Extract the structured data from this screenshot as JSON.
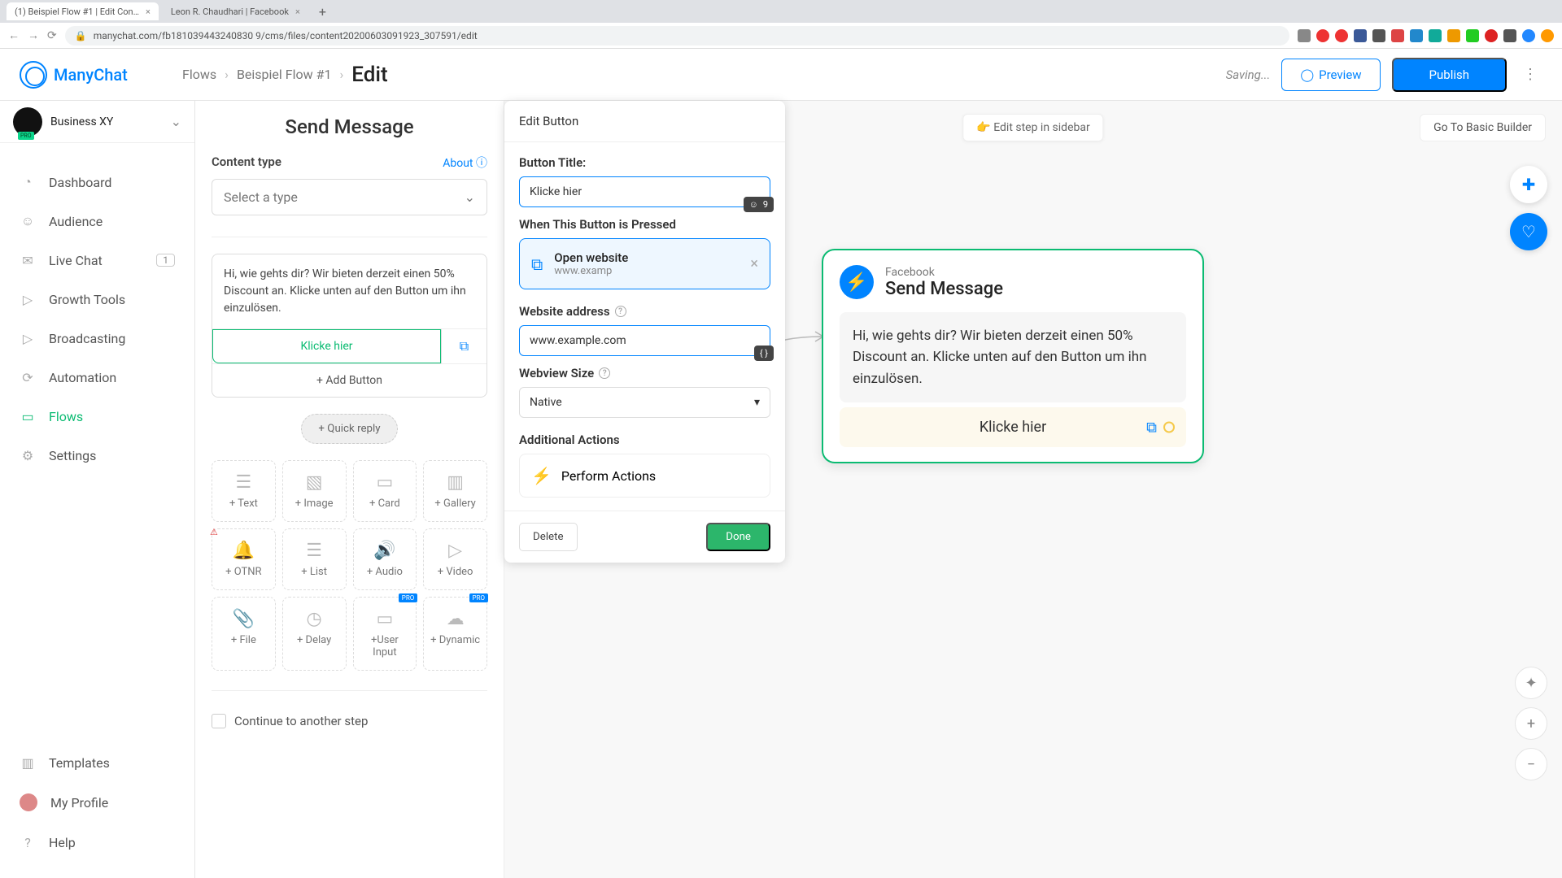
{
  "browser": {
    "tabs": [
      {
        "title": "(1) Beispiel Flow #1 | Edit Con…"
      },
      {
        "title": "Leon R. Chaudhari | Facebook"
      }
    ],
    "url": "manychat.com/fb181039443240830 9/cms/files/content20200603091923_307591/edit"
  },
  "logo": "ManyChat",
  "breadcrumbs": {
    "a": "Flows",
    "b": "Beispiel Flow #1",
    "c": "Edit"
  },
  "top": {
    "saving": "Saving...",
    "preview": "Preview",
    "publish": "Publish"
  },
  "workspace": {
    "name": "Business XY"
  },
  "sidebar": {
    "items": [
      {
        "label": "Dashboard"
      },
      {
        "label": "Audience"
      },
      {
        "label": "Live Chat",
        "badge": "1"
      },
      {
        "label": "Growth Tools"
      },
      {
        "label": "Broadcasting"
      },
      {
        "label": "Automation"
      },
      {
        "label": "Flows",
        "active": true
      },
      {
        "label": "Settings"
      }
    ],
    "bottom": [
      {
        "label": "Templates"
      },
      {
        "label": "My Profile"
      },
      {
        "label": "Help"
      }
    ]
  },
  "editor": {
    "title": "Send Message",
    "content_type_label": "Content type",
    "about": "About",
    "select_placeholder": "Select a type",
    "message": "Hi, wie gehts dir? Wir bieten derzeit einen 50% Discount an. Klicke unten auf den Button um ihn einzulösen.",
    "button_label": "Klicke hier",
    "add_button": "+ Add Button",
    "quick_reply": "+ Quick reply",
    "blocks": [
      "+ Text",
      "+ Image",
      "+ Card",
      "+ Gallery",
      "+ OTNR",
      "+ List",
      "+ Audio",
      "+ Video",
      "+ File",
      "+ Delay",
      "+User Input",
      "+ Dynamic"
    ],
    "continue": "Continue to another step"
  },
  "popover": {
    "head": "Edit Button",
    "title_label": "Button Title:",
    "title_value": "Klicke hier",
    "char_count": "9",
    "pressed_label": "When This Button is Pressed",
    "action_title": "Open website",
    "action_sub": "www.examp",
    "addr_label": "Website address",
    "addr_value": "www.example.com",
    "webview_label": "Webview Size",
    "webview_value": "Native",
    "additional": "Additional Actions",
    "perform": "Perform Actions",
    "delete": "Delete",
    "done": "Done"
  },
  "canvas": {
    "edit_step": "Edit step in sidebar",
    "go_basic": "Go To Basic Builder",
    "node_sub": "Facebook",
    "node_title": "Send Message",
    "node_msg": "Hi, wie gehts dir? Wir bieten derzeit einen 50% Discount an. Klicke unten auf den Button um ihn einzulösen.",
    "node_btn": "Klicke hier"
  }
}
